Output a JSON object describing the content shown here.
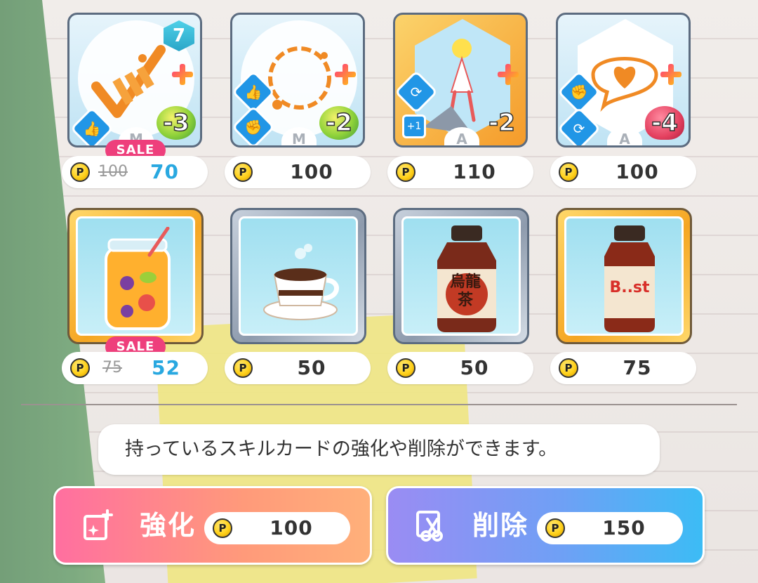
{
  "shop": {
    "skill_cards": [
      {
        "level": "7",
        "cost": "-3",
        "price_original": "100",
        "price": "70",
        "sale_label": "SALE",
        "rarity": "M"
      },
      {
        "cost": "-2",
        "price": "100",
        "rarity": "M"
      },
      {
        "cost": "-2",
        "price": "110",
        "rarity": "A",
        "effect_badge": "+1"
      },
      {
        "cost": "-4",
        "price": "100",
        "rarity": "A"
      }
    ],
    "drink_items": [
      {
        "name_icon": "fruit-juice-jar-icon",
        "price_original": "75",
        "price": "52",
        "sale_label": "SALE"
      },
      {
        "name_icon": "coffee-cup-icon",
        "price": "50"
      },
      {
        "name_icon": "oolong-tea-bottle-icon",
        "price": "50",
        "label_text": "烏龍茶"
      },
      {
        "name_icon": "boost-drink-bottle-icon",
        "price": "75",
        "label_text": "B..st"
      }
    ]
  },
  "description": "持っているスキルカードの強化や削除ができます。",
  "actions": {
    "enhance": {
      "label": "強化",
      "price": "100"
    },
    "delete": {
      "label": "削除",
      "price": "150"
    }
  },
  "coin_symbol": "P",
  "colors": {
    "sale": "#ee3f7c",
    "sale_price": "#29a8e0",
    "enhance_button": "#ff7f9a",
    "delete_button": "#6fa0f5"
  }
}
